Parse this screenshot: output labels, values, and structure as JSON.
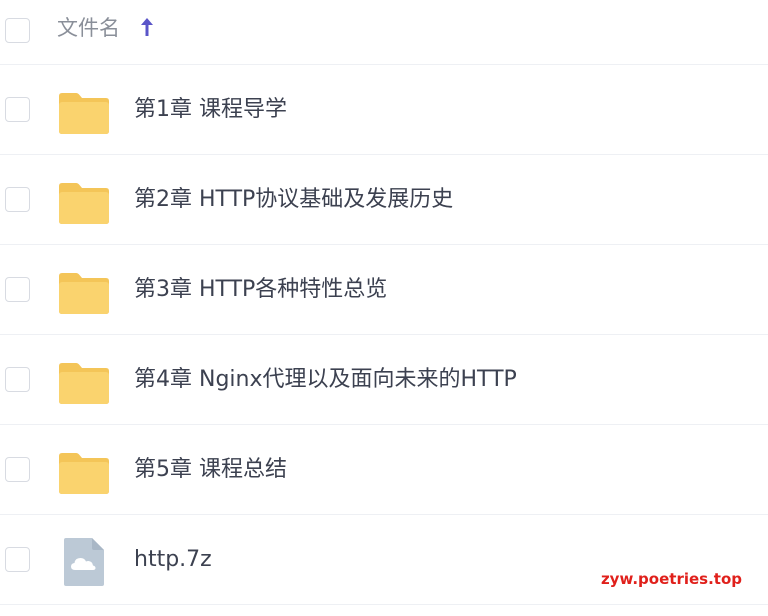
{
  "header": {
    "column_label": "文件名",
    "sort_direction": "ascending",
    "sort_icon": "arrow-up-icon",
    "accent_color": "#5a55c8"
  },
  "files": [
    {
      "name": "第1章 课程导学",
      "type": "folder",
      "icon": "folder-icon"
    },
    {
      "name": "第2章 HTTP协议基础及发展历史",
      "type": "folder",
      "icon": "folder-icon"
    },
    {
      "name": "第3章 HTTP各种特性总览",
      "type": "folder",
      "icon": "folder-icon"
    },
    {
      "name": "第4章 Nginx代理以及面向未来的HTTP",
      "type": "folder",
      "icon": "folder-icon"
    },
    {
      "name": "第5章 课程总结",
      "type": "folder",
      "icon": "folder-icon"
    },
    {
      "name": "http.7z",
      "type": "file",
      "icon": "cloud-file-icon"
    }
  ],
  "watermark": "zyw.poetries.top",
  "colors": {
    "folder": "#fad36e",
    "file_icon": "#bcc9d6",
    "text": "#3c4150",
    "watermark": "#e0201b"
  }
}
